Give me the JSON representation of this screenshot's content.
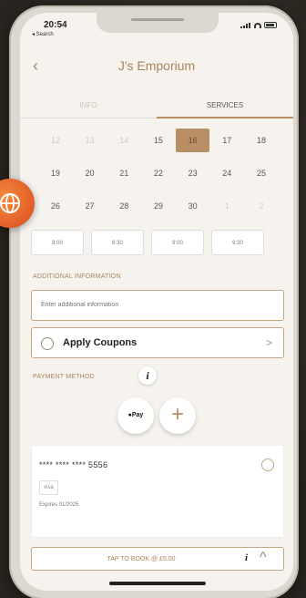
{
  "status": {
    "time": "20:54",
    "back_to": "◂ Search"
  },
  "header": {
    "title": "J's Emporium",
    "back_icon": "chevron-left-icon"
  },
  "tabs": [
    {
      "label": "INFO",
      "active": false
    },
    {
      "label": "SERVICES",
      "active": true
    }
  ],
  "calendar": {
    "rows": [
      [
        "12",
        "13",
        "14",
        "15",
        "16",
        "17",
        "18"
      ],
      [
        "19",
        "20",
        "21",
        "22",
        "23",
        "24",
        "25"
      ],
      [
        "26",
        "27",
        "28",
        "29",
        "30",
        "1",
        "2"
      ]
    ],
    "selected": "16",
    "accent": "#b88e65"
  },
  "time_slots": [
    "8:00",
    "8:30",
    "9:00",
    "9:30"
  ],
  "additional_info": {
    "label": "ADDITIONAL INFORMATION",
    "placeholder": "Enter additional information"
  },
  "coupons": {
    "label": "Apply Coupons",
    "icon": "coupon-icon",
    "chevron": ">"
  },
  "payment": {
    "label": "PAYMENT METHOD",
    "info_icon": "i",
    "apple_pay_label": "Pay",
    "add_label": "+"
  },
  "card": {
    "number": "**** **** **** 5556",
    "type": "visa",
    "expiry": "Expires 01/2025"
  },
  "booking": {
    "label": "TAP TO BOOK @ £5.00",
    "info_icon": "i",
    "chevron": "^"
  },
  "colors": {
    "accent": "#b88e65",
    "brand_text": "#a8835a",
    "badge": "#e8602a"
  }
}
